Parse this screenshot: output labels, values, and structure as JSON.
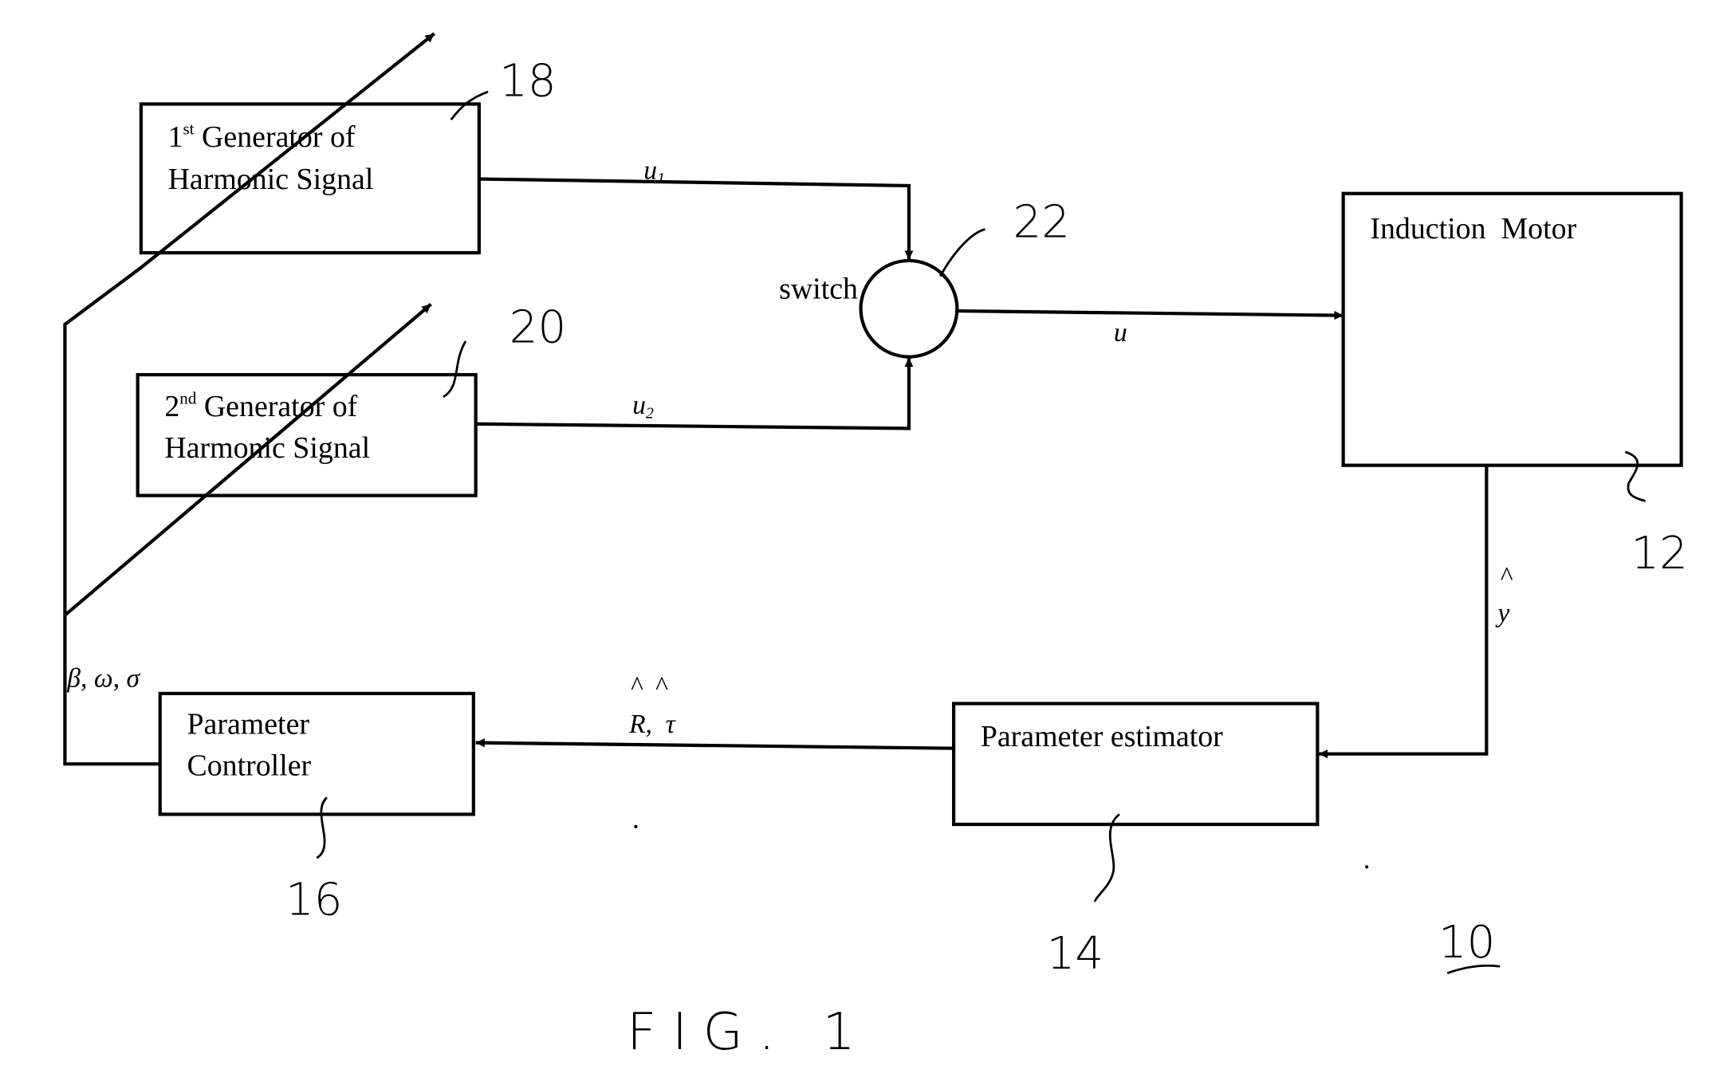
{
  "figure": {
    "caption": "FIG. 1",
    "system_ref": "10"
  },
  "blocks": {
    "gen1": {
      "line1_prefix": "1",
      "line1_sup": "st",
      "line1_rest": " Generator of",
      "line2": "Harmonic Signal",
      "ref": "18"
    },
    "gen2": {
      "line1_prefix": "2",
      "line1_sup": "nd",
      "line1_rest": " Generator of",
      "line2": "Harmonic Signal",
      "ref": "20"
    },
    "switch": {
      "label": "switch",
      "ref": "22"
    },
    "motor": {
      "label": "Induction  Motor",
      "ref": "12"
    },
    "estimator": {
      "label": "Parameter estimator",
      "ref": "14"
    },
    "controller": {
      "line1": "Parameter",
      "line2": "Controller",
      "ref": "16"
    }
  },
  "signals": {
    "u1": {
      "base": "u",
      "sub": "1"
    },
    "u2": {
      "base": "u",
      "sub": "2"
    },
    "u": "u",
    "y_hat": {
      "hat": "^",
      "base": "y"
    },
    "estimates": {
      "hats": "^  ^",
      "text": "R,  τ"
    },
    "control_params": "β, ω, σ"
  }
}
